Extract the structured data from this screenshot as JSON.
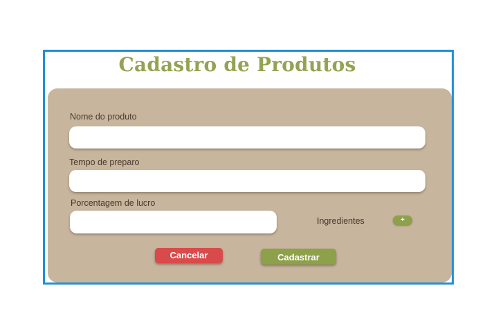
{
  "form": {
    "title": "Cadastro de Produtos",
    "fields": {
      "product_name": {
        "label": "Nome do produto",
        "value": "",
        "placeholder": ""
      },
      "prep_time": {
        "label": "Tempo de preparo",
        "value": "",
        "placeholder": ""
      },
      "profit_percentage": {
        "label": "Porcentagem de lucro",
        "value": "",
        "placeholder": ""
      }
    },
    "ingredients": {
      "label": "Ingredientes",
      "add_label": "+"
    },
    "buttons": {
      "cancel_label": "Cancelar",
      "submit_label": "Cadastrar"
    }
  },
  "colors": {
    "frame_border": "#1f8fd6",
    "title": "#93a352",
    "panel": "#c8b59e",
    "cancel": "#d94a4a",
    "submit": "#8da04a"
  }
}
